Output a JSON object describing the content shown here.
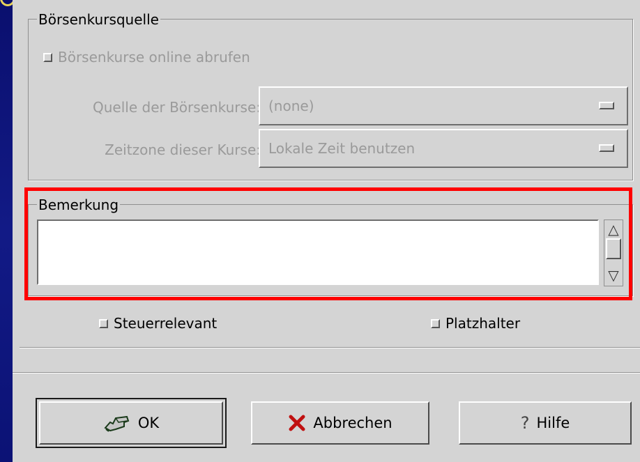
{
  "source_group": {
    "title": "Börsenkursquelle",
    "online_checkbox_label": "Börsenkurse online abrufen",
    "source_label": "Quelle der Börsenkurse:",
    "source_value": "(none)",
    "timezone_label": "Zeitzone dieser Kurse:",
    "timezone_value": "Lokale Zeit benutzen"
  },
  "remark_group": {
    "title": "Bemerkung",
    "text": ""
  },
  "options": {
    "tax_relevant_label": "Steuerrelevant",
    "placeholder_label": "Platzhalter"
  },
  "buttons": {
    "ok": "OK",
    "cancel": "Abbrechen",
    "help": "Hilfe"
  },
  "icons": {
    "ok": "hand-pointing-icon",
    "cancel": "red-x-icon",
    "help": "question-mark-icon"
  },
  "colors": {
    "background": "#121a86",
    "dialog": "#d4d4d4",
    "highlight": "#ff0000"
  }
}
